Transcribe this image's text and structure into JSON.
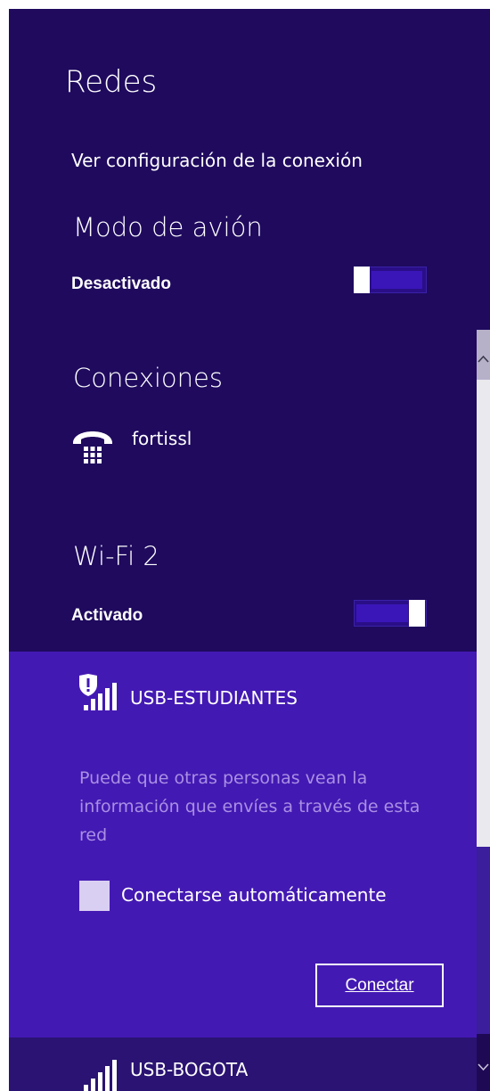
{
  "panel": {
    "title": "Redes",
    "settings_link": "Ver configuración de la conexión"
  },
  "airplane": {
    "heading": "Modo de avión",
    "state": "Desactivado",
    "toggle_on": false
  },
  "connections": {
    "heading": "Conexiones",
    "items": [
      {
        "name": "fortissl",
        "icon": "dialup-phone-icon"
      }
    ]
  },
  "wifi": {
    "heading": "Wi-Fi 2",
    "state": "Activado",
    "toggle_on": true,
    "networks": [
      {
        "name": "USB-ESTUDIANTES",
        "icon": "wifi-signal-shield-icon",
        "warning": "Puede que otras personas vean la información que envíes a través de esta red",
        "auto_connect_label": "Conectarse automáticamente",
        "auto_connect_checked": false,
        "connect_label": "Conectar"
      },
      {
        "name": "USB-BOGOTA",
        "icon": "wifi-signal-icon"
      }
    ]
  },
  "colors": {
    "panel_bg": "#1f0a5e",
    "selected_bg": "#4319b3",
    "accent": "#3a16b9",
    "warning_text": "#a98fe4"
  }
}
